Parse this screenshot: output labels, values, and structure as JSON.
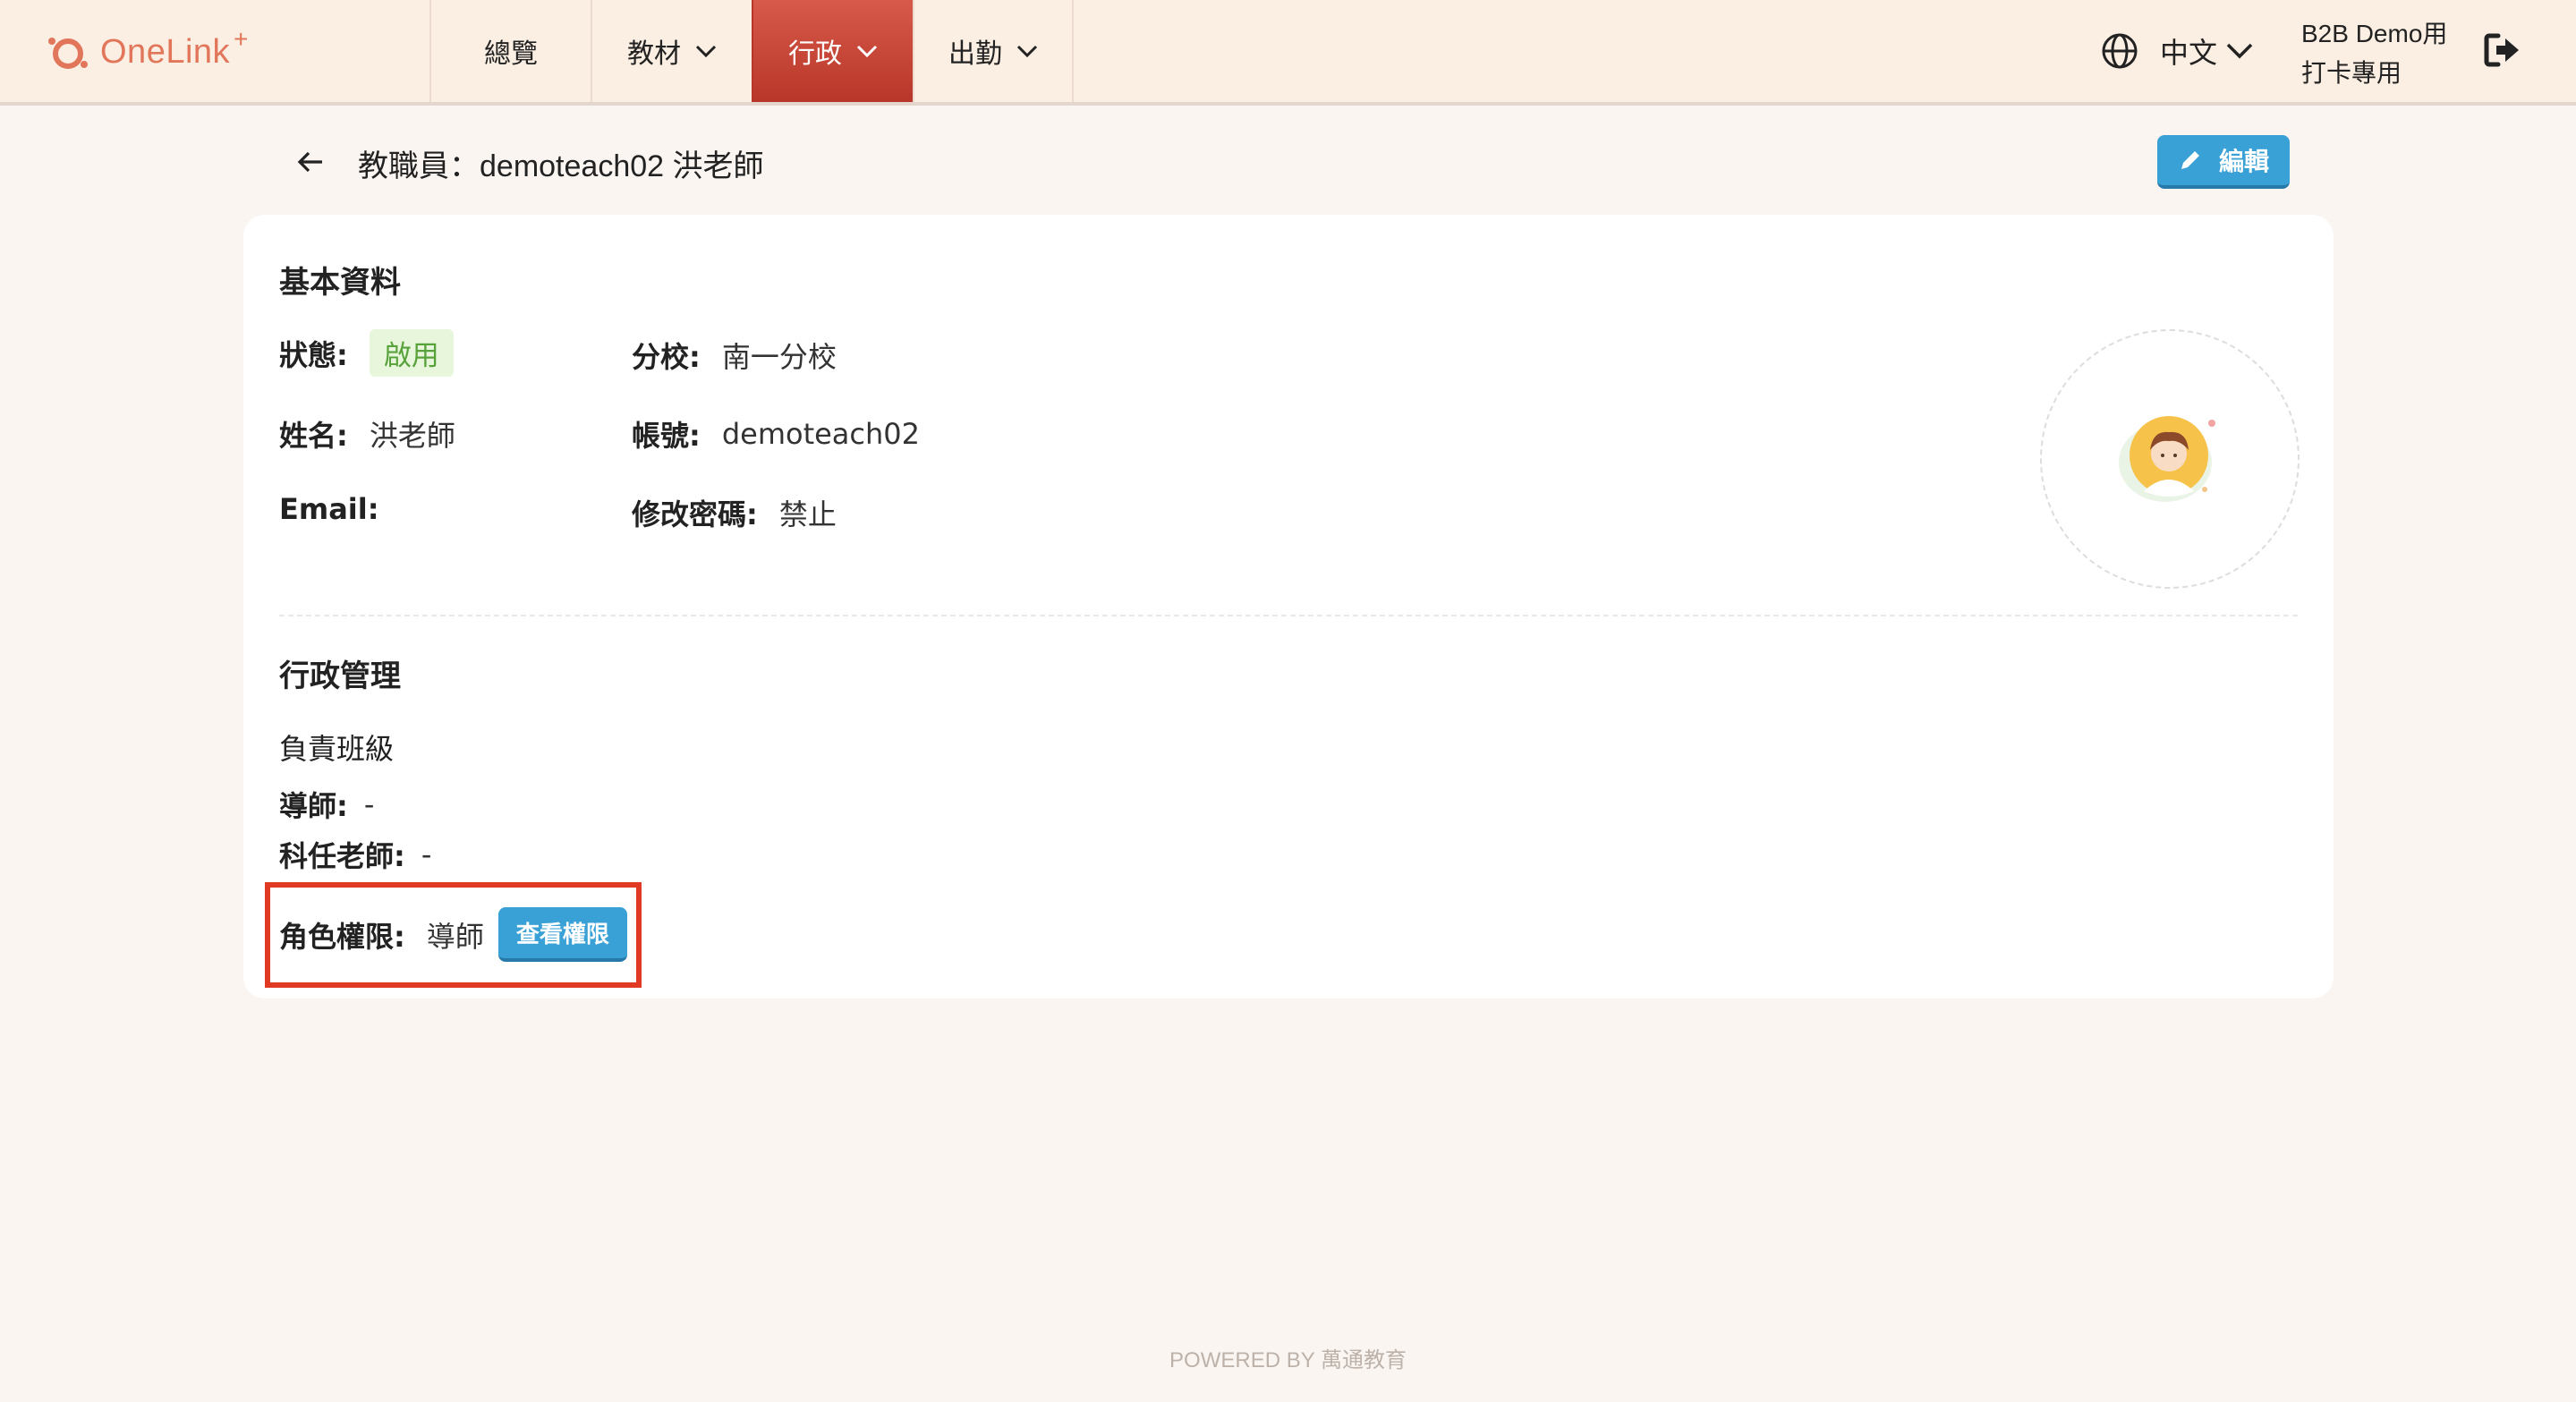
{
  "brand": {
    "name": "OneLink",
    "plus": "+"
  },
  "nav": {
    "items": [
      {
        "label": "總覽",
        "has_dropdown": false,
        "active": false
      },
      {
        "label": "教材",
        "has_dropdown": true,
        "active": false
      },
      {
        "label": "行政",
        "has_dropdown": true,
        "active": true
      },
      {
        "label": "出勤",
        "has_dropdown": true,
        "active": false
      }
    ]
  },
  "header": {
    "language": "中文",
    "user_line1": "B2B Demo用",
    "user_line2": "打卡專用"
  },
  "page": {
    "title": "教職員：demoteach02 洪老師",
    "edit_label": "編輯"
  },
  "basic": {
    "section_title": "基本資料",
    "status_label": "狀態:",
    "status_value": "啟用",
    "branch_label": "分校:",
    "branch_value": "南一分校",
    "name_label": "姓名:",
    "name_value": "洪老師",
    "account_label": "帳號:",
    "account_value": "demoteach02",
    "email_label": "Email:",
    "email_value": "",
    "password_label": "修改密碼:",
    "password_value": "禁止"
  },
  "admin": {
    "section_title": "行政管理",
    "classes_heading": "負責班級",
    "tutor_label": "導師:",
    "tutor_value": "-",
    "subject_teacher_label": "科任老師:",
    "subject_teacher_value": "-",
    "role_label": "角色權限:",
    "role_value": "導師",
    "view_permissions_label": "查看權限"
  },
  "colors": {
    "accent_red": "#d75a4a",
    "button_blue": "#3aa1d6",
    "status_green": "#57a23a",
    "highlight_red": "#e03a24"
  },
  "footer": {
    "text": "POWERED BY 萬通教育"
  }
}
